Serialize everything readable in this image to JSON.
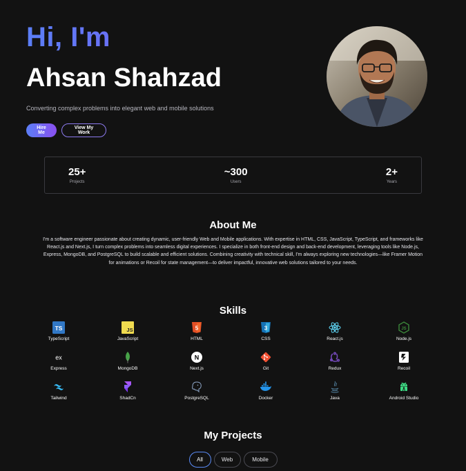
{
  "hero": {
    "greeting": "Hi, I'm",
    "name": "Ahsan Shahzad",
    "tagline": "Converting complex problems into elegant web and mobile solutions",
    "primary_button": "Hire Me",
    "secondary_button": "View My Work"
  },
  "stats": [
    {
      "value": "25+",
      "label": "Projects"
    },
    {
      "value": "~300",
      "label": "Users"
    },
    {
      "value": "2+",
      "label": "Years"
    }
  ],
  "about": {
    "title": "About Me",
    "text": "I'm a software engineer passionate about creating dynamic, user-friendly Web and Mobile applications. With expertise in HTML, CSS, JavaScript, TypeScript, and frameworks like React.js and Next.js, I turn complex problems into seamless digital experiences. I specialize in both front-end design and back-end development, leveraging tools like Node.js, Express, MongoDB, and PostgreSQL to build scalable and efficient solutions. Combining creativity with technical skill, I'm always exploring new technologies—like Framer Motion for animations or Recoil for state management—to deliver impactful, innovative web solutions tailored to your needs."
  },
  "skills": {
    "title": "Skills",
    "items": [
      {
        "label": "TypeScript",
        "icon": "typescript-icon"
      },
      {
        "label": "JavaScript",
        "icon": "javascript-icon"
      },
      {
        "label": "HTML",
        "icon": "html-icon"
      },
      {
        "label": "CSS",
        "icon": "css-icon"
      },
      {
        "label": "React.js",
        "icon": "react-icon"
      },
      {
        "label": "Node.js",
        "icon": "nodejs-icon"
      },
      {
        "label": "Express",
        "icon": "express-icon"
      },
      {
        "label": "MongoDB",
        "icon": "mongodb-icon"
      },
      {
        "label": "Next.js",
        "icon": "nextjs-icon"
      },
      {
        "label": "Git",
        "icon": "git-icon"
      },
      {
        "label": "Redux",
        "icon": "redux-icon"
      },
      {
        "label": "Recoil",
        "icon": "recoil-icon"
      },
      {
        "label": "Tailwind",
        "icon": "tailwind-icon"
      },
      {
        "label": "ShadCn",
        "icon": "shadcn-icon"
      },
      {
        "label": "PostgreSQL",
        "icon": "postgresql-icon"
      },
      {
        "label": "Docker",
        "icon": "docker-icon"
      },
      {
        "label": "Java",
        "icon": "java-icon"
      },
      {
        "label": "Android Studio",
        "icon": "android-studio-icon"
      }
    ]
  },
  "projects": {
    "title": "My Projects",
    "filters": [
      "All",
      "Web",
      "Mobile"
    ],
    "active_filter": "All"
  },
  "colors": {
    "background": "#121212",
    "accent_start": "#5b7ff7",
    "accent_end": "#8a4ff0"
  }
}
